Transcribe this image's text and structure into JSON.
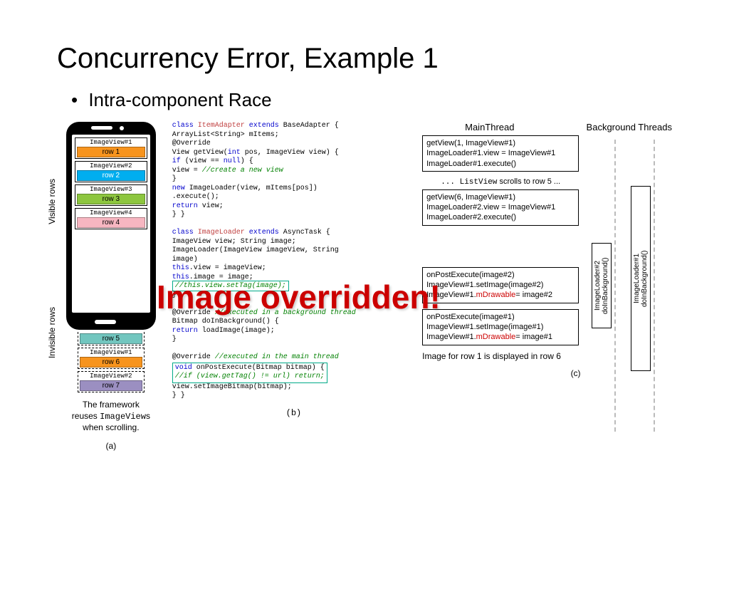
{
  "title": "Concurrency Error, Example 1",
  "bullet": "Intra-component Race",
  "overlay": "Image overridden!",
  "labels": {
    "visible": "Visible rows",
    "invisible": "Invisible rows",
    "caption_a": "The framework",
    "caption_b": "reuses ",
    "caption_code": "ImageView",
    "caption_c": "s",
    "caption_d": "when scrolling.",
    "fig_a": "(a)",
    "fig_b": "(b)",
    "fig_c": "(c)"
  },
  "rows": [
    {
      "label": "ImageView#1",
      "bar": "row 1",
      "color": "c-orange",
      "inPhone": true
    },
    {
      "label": "ImageView#2",
      "bar": "row 2",
      "color": "c-blue",
      "inPhone": true
    },
    {
      "label": "ImageView#3",
      "bar": "row 3",
      "color": "c-green",
      "inPhone": true
    },
    {
      "label": "ImageView#4",
      "bar": "row 4",
      "color": "c-pink",
      "inPhone": true
    },
    {
      "label": "",
      "bar": "row 5",
      "color": "c-teal",
      "inPhone": false,
      "dashed": true
    },
    {
      "label": "ImageView#1",
      "bar": "row 6",
      "color": "c-orange",
      "inPhone": false,
      "dashed": true
    },
    {
      "label": "ImageView#2",
      "bar": "row 7",
      "color": "c-purple",
      "inPhone": false,
      "dashed": true
    }
  ],
  "code": {
    "l01": "class",
    "l02": " ItemAdapter ",
    "l03": "extends",
    "l04": " BaseAdapter {",
    "l05": "  ArrayList<String> mItems;",
    "l06": "  @Override",
    "l07": "  View getView(",
    "l08": "int",
    "l09": " pos, ImageView view) {",
    "l10": "    if",
    "l11": " (view == ",
    "l12": "null",
    "l13": ") {",
    "l14": "      view = ",
    "l15": "//create a new view",
    "l16": "    }",
    "l17": "    new",
    "l18": " ImageLoader(view, mItems[pos])",
    "l19": "      .execute();",
    "l20": "    return",
    "l21": " view;",
    "l22": "  }  }",
    "l23": "class",
    "l24": " ImageLoader ",
    "l25": "extends",
    "l26": " AsyncTask {",
    "l27": "  ImageView view; String image;",
    "l28": "  ImageLoader(ImageView imageView, String",
    "l29": "      image)",
    "l30": "    this",
    "l31": ".view = imageView;",
    "l32": "    this",
    "l33": ".image = image;",
    "l34": "    //this.view.setTag(image);",
    "l35": "  }",
    "l36": "  @Override ",
    "l37": "//executed in a background thread",
    "l38": "  Bitmap doInBackground() {",
    "l39": "    return",
    "l40": " loadImage(image);",
    "l41": "  }",
    "l42": "  @Override ",
    "l43": "//executed in the main thread",
    "l44": "  void",
    "l45": " onPostExecute(Bitmap bitmap) {",
    "l46": "    //if (view.getTag() != url) return;",
    "l47": "    view.setImageBitmap(bitmap);",
    "l48": "  }  }"
  },
  "timeline": {
    "mainHead": "MainThread",
    "bgHead": "Background Threads",
    "b1a": "getView(1, ImageView#1)",
    "b1b": "ImageLoader#1.view = ImageView#1",
    "b1c": "ImageLoader#1.execute()",
    "scroll1": "... ",
    "scrollCode": "ListView",
    "scroll2": " scrolls to row ",
    "scroll3": "5",
    "scroll4": " ...",
    "b2a": "getView(6, ImageView#1)",
    "b2b": "ImageLoader#2.view = ImageView#1",
    "b2c": "ImageLoader#2.execute()",
    "b3a": "onPostExecute(image#2)",
    "b3b": "ImageView#1.setImage(image#2)",
    "b3c1": "ImageView#1.",
    "b3c2": "mDrawable",
    "b3c3": "= image#2",
    "b4a": "onPostExecute(image#1)",
    "b4b": "ImageView#1.setImage(image#1)",
    "b4c1": "ImageView#1.",
    "b4c2": "mDrawable",
    "b4c3": "= image#1",
    "sb2a": "ImageLoader#2",
    "sb2b": "doInBackground()",
    "sb1a": "ImageLoader#1",
    "sb1b": "doInBackground()",
    "footer1": "Image for row ",
    "footer2": "1",
    "footer3": " is displayed in row ",
    "footer4": "6"
  }
}
